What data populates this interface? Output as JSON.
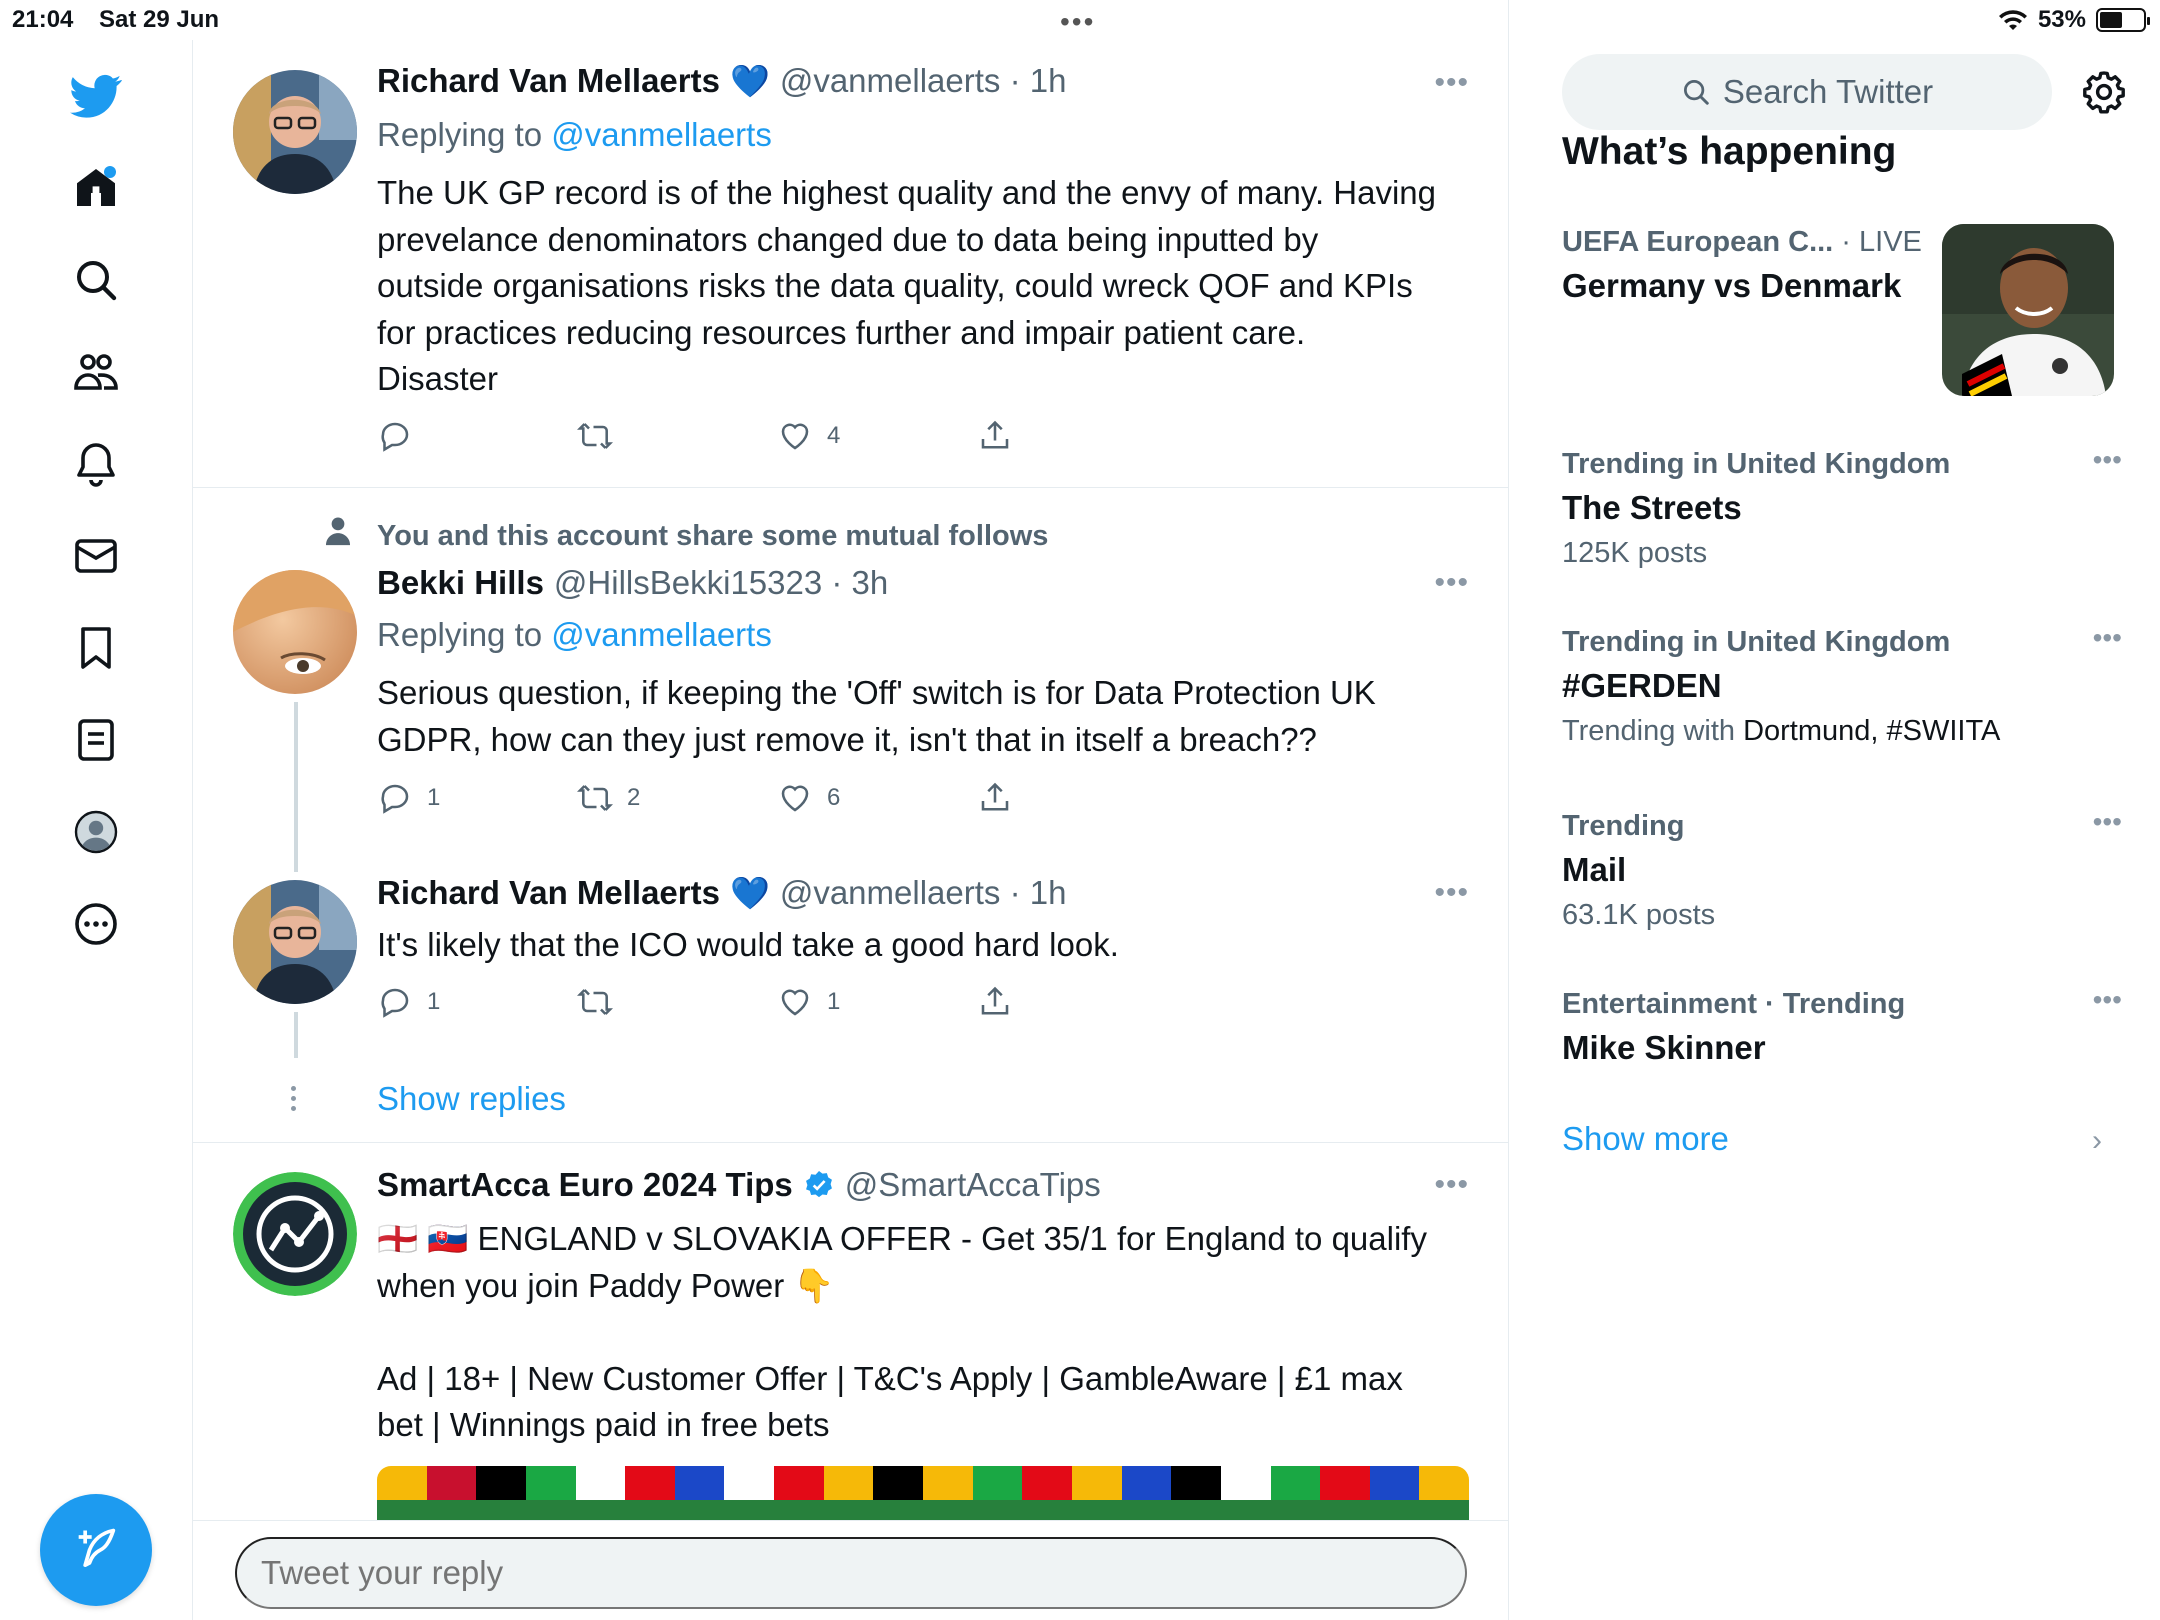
{
  "status_bar": {
    "time": "21:04",
    "date": "Sat 29 Jun",
    "battery": "53%",
    "battery_level": 0.53
  },
  "nav": {
    "items": [
      "twitter-logo",
      "home",
      "explore",
      "communities",
      "notifications",
      "messages",
      "bookmarks",
      "lists",
      "profile",
      "more"
    ]
  },
  "tweets": [
    {
      "name": "Richard Van Mellaerts",
      "emoji": "💙",
      "handle": "@vanmellaerts · 1h",
      "replying_prefix": "Replying to ",
      "replying_handle": "@vanmellaerts",
      "text_lines": [
        "The UK GP record is of the highest quality and the envy of many. Having",
        "prevelance denominators changed due to data being inputted by",
        "outside organisations risks the data quality, could wreck QOF and KPIs",
        "for practices reducing resources further and impair patient care.",
        "Disaster"
      ],
      "replies": "",
      "retweets": "",
      "likes": "4"
    },
    {
      "social_context": "You and this account share some mutual follows",
      "name": "Bekki Hills",
      "handle": "@HillsBekki15323 · 3h",
      "replying_prefix": "Replying to ",
      "replying_handle": "@vanmellaerts",
      "text_lines": [
        "Serious question, if keeping the 'Off' switch is for Data Protection UK",
        "GDPR, how can they just remove it, isn't that in itself a breach??"
      ],
      "replies": "1",
      "retweets": "2",
      "likes": "6"
    },
    {
      "name": "Richard Van Mellaerts",
      "emoji": "💙",
      "handle": "@vanmellaerts · 1h",
      "text_lines": [
        "It's likely that the ICO would take a good hard look."
      ],
      "replies": "1",
      "retweets": "",
      "likes": "1",
      "show_replies": "Show replies"
    },
    {
      "name": "SmartAcca Euro 2024 Tips",
      "handle": "@SmartAccaTips",
      "text_lines": [
        "🏴󠁧󠁢󠁥󠁮󠁧󠁿 🇸🇰 ENGLAND v SLOVAKIA OFFER - Get 35/1 for England to qualify",
        "when you join Paddy Power 👇",
        "",
        "Ad | 18+ | New Customer Offer | T&C's Apply | GambleAware | £1 max",
        "bet | Winnings paid in free bets"
      ]
    }
  ],
  "reply_placeholder": "Tweet your reply",
  "right": {
    "search_placeholder": "Search Twitter",
    "section_title": "What’s happening",
    "live": {
      "meta": "UEFA European C...",
      "live_label": " · LIVE",
      "title": "Germany vs Denmark"
    },
    "trends": [
      {
        "meta": "Trending in United Kingdom",
        "title": "The Streets",
        "sub": "125K posts"
      },
      {
        "meta": "Trending in United Kingdom",
        "title": "#GERDEN",
        "sub_prefix": "Trending with ",
        "sub_rest": "Dortmund, #SWIITA"
      },
      {
        "meta": "Trending",
        "title": "Mail",
        "sub": "63.1K posts"
      },
      {
        "meta": "Entertainment · Trending",
        "title": "Mike Skinner"
      }
    ],
    "show_more": "Show more"
  },
  "colors": {
    "accent": "#1d9bf0",
    "text": "#0f1419",
    "secondary": "#536471",
    "border": "#e6ecf0"
  }
}
